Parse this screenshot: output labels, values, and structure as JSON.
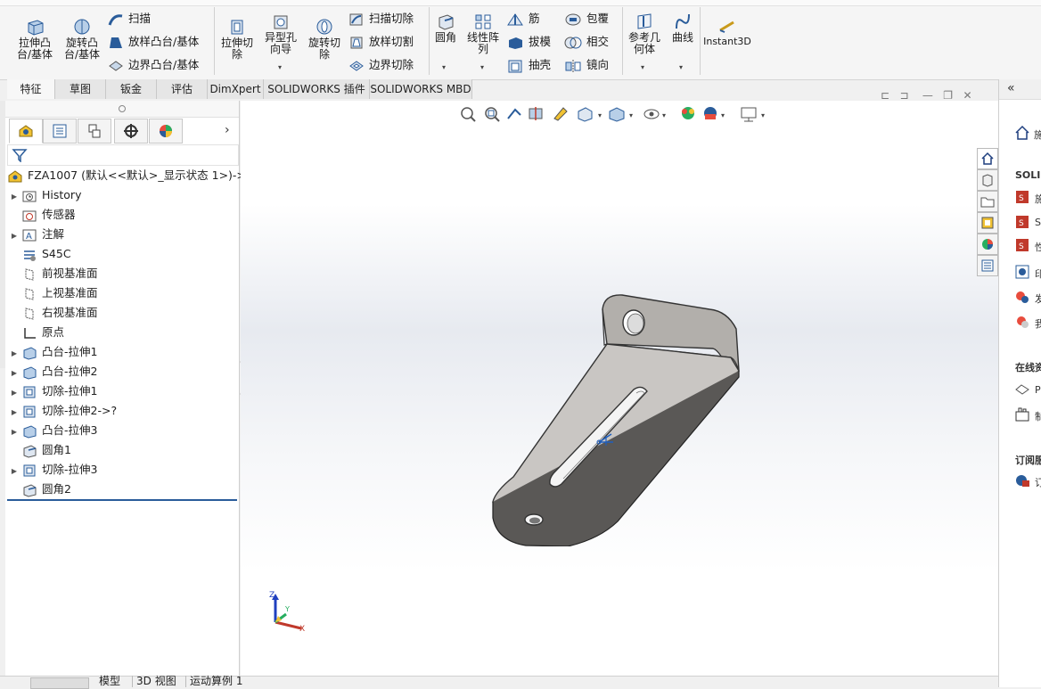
{
  "ribbon": {
    "extrude_boss": "拉伸凸\n台/基体",
    "revolve_boss": "旋转凸\n台/基体",
    "sweep": "扫描",
    "loft_boss": "放样凸台/基体",
    "boundary_boss": "边界凸台/基体",
    "extrude_cut": "拉伸切\n除",
    "hole_wizard": "异型孔\n向导",
    "revolve_cut": "旋转切\n除",
    "swept_cut": "扫描切除",
    "lofted_cut": "放样切割",
    "boundary_cut": "边界切除",
    "fillet": "圆角",
    "linear_pattern": "线性阵\n列",
    "rib": "筋",
    "draft": "拔模",
    "shell": "抽壳",
    "wrap": "包覆",
    "intersect": "相交",
    "mirror": "镜向",
    "ref_geometry": "参考几\n何体",
    "curves": "曲线",
    "instant3d": "Instant3D"
  },
  "tabs": [
    "特征",
    "草图",
    "钣金",
    "评估",
    "DimXpert",
    "SOLIDWORKS 插件",
    "SOLIDWORKS MBD"
  ],
  "tree": {
    "root": "FZA1007  (默认<<默认>_显示状态 1>)->?",
    "items": [
      {
        "label": "History",
        "icon": "history-folder-icon",
        "expandable": true
      },
      {
        "label": "传感器",
        "icon": "sensor-icon",
        "expandable": false
      },
      {
        "label": "注解",
        "icon": "annotation-icon",
        "expandable": true
      },
      {
        "label": "S45C",
        "icon": "material-icon",
        "expandable": false
      },
      {
        "label": "前视基准面",
        "icon": "plane-icon",
        "expandable": false
      },
      {
        "label": "上视基准面",
        "icon": "plane-icon",
        "expandable": false
      },
      {
        "label": "右视基准面",
        "icon": "plane-icon",
        "expandable": false
      },
      {
        "label": "原点",
        "icon": "origin-icon",
        "expandable": false
      },
      {
        "label": "凸台-拉伸1",
        "icon": "boss-extrude-icon",
        "expandable": true
      },
      {
        "label": "凸台-拉伸2",
        "icon": "boss-extrude-icon",
        "expandable": true
      },
      {
        "label": "切除-拉伸1",
        "icon": "cut-extrude-icon",
        "expandable": true
      },
      {
        "label": "切除-拉伸2->?",
        "icon": "cut-extrude-icon",
        "expandable": true
      },
      {
        "label": "凸台-拉伸3",
        "icon": "boss-extrude-icon",
        "expandable": true
      },
      {
        "label": "圆角1",
        "icon": "fillet-icon",
        "expandable": false
      },
      {
        "label": "切除-拉伸3",
        "icon": "cut-extrude-icon",
        "expandable": true
      },
      {
        "label": "圆角2",
        "icon": "fillet-icon",
        "expandable": false
      }
    ]
  },
  "triad": {
    "x": "X",
    "y": "Y",
    "z": "Z"
  },
  "task_pane": {
    "section1": "SOLID",
    "section2": "在线资",
    "section3": "订阅服",
    "items": [
      "施",
      "S",
      "性",
      "印",
      "发",
      "我",
      "P",
      "制",
      "订"
    ]
  },
  "bottom_tabs": [
    "模型",
    "3D 视图",
    "运动算例 1"
  ],
  "colors": {
    "part_face": "#c9c6c3",
    "part_edge": "#3a3a3a",
    "accent_blue": "#1f5fbf"
  }
}
